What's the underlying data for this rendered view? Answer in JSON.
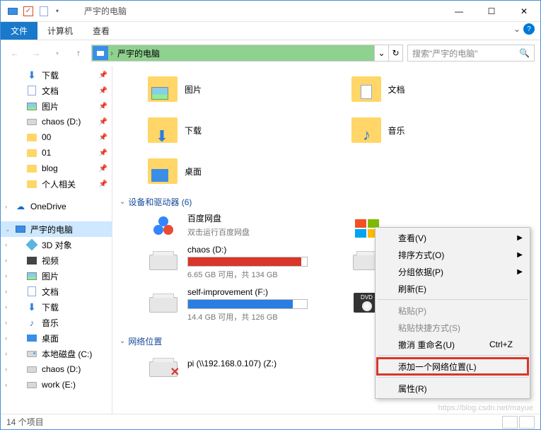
{
  "window": {
    "title": "严宇的电脑",
    "min": "—",
    "max": "☐",
    "close": "✕"
  },
  "ribbon": {
    "file": "文件",
    "computer": "计算机",
    "view": "查看"
  },
  "addressbar": {
    "path": "严宇的电脑"
  },
  "search": {
    "placeholder": "搜索\"严宇的电脑\""
  },
  "sidebar": {
    "items": [
      {
        "label": "下载",
        "pin": true,
        "icon": "dl"
      },
      {
        "label": "文档",
        "pin": true,
        "icon": "doc"
      },
      {
        "label": "图片",
        "pin": true,
        "icon": "pic"
      },
      {
        "label": "chaos (D:)",
        "pin": true,
        "icon": "drive"
      },
      {
        "label": "00",
        "pin": true,
        "icon": "folder"
      },
      {
        "label": "01",
        "pin": true,
        "icon": "folder"
      },
      {
        "label": "blog",
        "pin": true,
        "icon": "folder"
      },
      {
        "label": "个人相关",
        "pin": true,
        "icon": "folder"
      }
    ],
    "onedrive": "OneDrive",
    "thispc": "严宇的电脑",
    "pcitems": [
      {
        "label": "3D 对象",
        "icon": "3d"
      },
      {
        "label": "视频",
        "icon": "video"
      },
      {
        "label": "图片",
        "icon": "pic"
      },
      {
        "label": "文档",
        "icon": "doc"
      },
      {
        "label": "下载",
        "icon": "dl"
      },
      {
        "label": "音乐",
        "icon": "music"
      },
      {
        "label": "桌面",
        "icon": "desktop"
      },
      {
        "label": "本地磁盘 (C:)",
        "icon": "drivec"
      },
      {
        "label": "chaos (D:)",
        "icon": "drive"
      },
      {
        "label": "work (E:)",
        "icon": "drive"
      }
    ]
  },
  "content": {
    "folders": [
      {
        "label": "图片",
        "inset": "pic"
      },
      {
        "label": "文档",
        "inset": "doc"
      },
      {
        "label": "下载",
        "inset": "dl"
      },
      {
        "label": "音乐",
        "inset": "music"
      },
      {
        "label": "桌面",
        "inset": "desk"
      }
    ],
    "devices_header": "设备和驱动器 (6)",
    "baidu": {
      "name": "百度网盘",
      "sub": "双击运行百度网盘"
    },
    "drives": [
      {
        "name": "chaos (D:)",
        "sub": "6.65 GB 可用，共 134 GB",
        "pct": 95,
        "color": "red"
      },
      {
        "name": "self-improvement (F:)",
        "sub": "14.4 GB 可用，共 126 GB",
        "pct": 88,
        "color": "blue"
      }
    ],
    "network_header": "网络位置",
    "netloc": {
      "name": "pi (\\\\192.168.0.107) (Z:)"
    }
  },
  "contextmenu": {
    "items": [
      {
        "label": "查看(V)",
        "sub": true
      },
      {
        "label": "排序方式(O)",
        "sub": true
      },
      {
        "label": "分组依据(P)",
        "sub": true
      },
      {
        "label": "刷新(E)"
      },
      {
        "sep": true
      },
      {
        "label": "粘贴(P)",
        "disabled": true
      },
      {
        "label": "粘贴快捷方式(S)",
        "disabled": true
      },
      {
        "label": "撤消 重命名(U)",
        "shortcut": "Ctrl+Z"
      },
      {
        "sep": true
      },
      {
        "label": "添加一个网络位置(L)",
        "highlighted": true
      },
      {
        "sep": true
      },
      {
        "label": "属性(R)"
      }
    ]
  },
  "statusbar": {
    "count": "14 个项目"
  },
  "watermark": "https://blog.csdn.net/mayue"
}
